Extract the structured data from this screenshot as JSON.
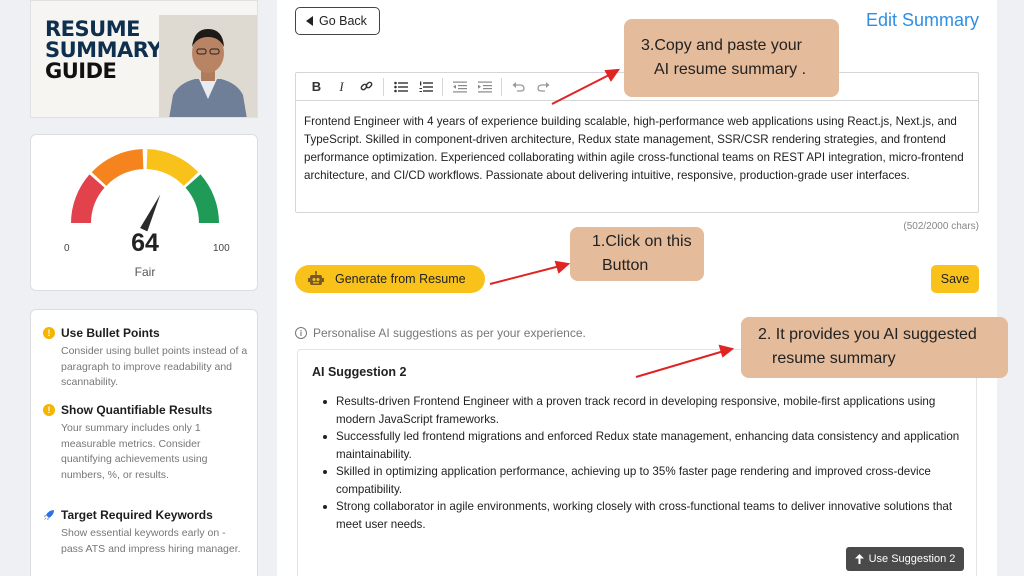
{
  "sidebar": {
    "guide_title": [
      "RESUME",
      "SUMMARY",
      "GUIDE"
    ],
    "score": {
      "value": "64",
      "min": "0",
      "max": "100",
      "label": "Fair",
      "fraction": 0.64
    },
    "tips": [
      {
        "title": "Use Bullet Points",
        "body": "Consider using bullet points instead of a paragraph to improve readability and scannability.",
        "icon": "warning-icon"
      },
      {
        "title": "Show Quantifiable Results",
        "body": "Your summary includes only 1 measurable metrics. Consider quantifying achievements using numbers, %, or results.",
        "icon": "warning-icon"
      },
      {
        "title": "Target Required Keywords",
        "body": "Show essential keywords early on - pass ATS and impress hiring manager.",
        "icon": "rocket-icon"
      }
    ]
  },
  "header": {
    "back_label": "Go Back",
    "title": "Edit Summary"
  },
  "toolbar": [
    "B",
    "I",
    "link",
    "bullet-list",
    "numbered-list",
    "outdent",
    "indent",
    "undo",
    "redo"
  ],
  "editor": {
    "text": "Frontend Engineer with 4 years of experience building scalable, high-performance web applications using React.js, Next.js, and TypeScript. Skilled in component-driven architecture, Redux state management, SSR/CSR rendering strategies, and frontend performance optimization. Experienced collaborating within agile cross-functional teams on REST API integration, micro-frontend architecture, and CI/CD workflows. Passionate about delivering intuitive, responsive, production-grade user interfaces.",
    "char_count": "(502/2000 chars)"
  },
  "actions": {
    "generate_label": "Generate from Resume",
    "save_label": "Save"
  },
  "personalise_text": "Personalise AI suggestions as per your experience.",
  "suggestion": {
    "title": "AI Suggestion 2",
    "items": [
      "Results-driven Frontend Engineer with a proven track record in developing responsive, mobile-first applications using modern JavaScript frameworks.",
      "Successfully led frontend migrations and enforced Redux state management, enhancing data consistency and application maintainability.",
      "Skilled in optimizing application performance, achieving up to 35% faster page rendering and improved cross-device compatibility.",
      "Strong collaborator in agile environments, working closely with cross-functional teams to deliver innovative solutions that meet user needs."
    ],
    "use_label": "Use Suggestion 2"
  },
  "callouts": {
    "copy_paste": [
      "3.Copy and paste your",
      "AI resume summary ."
    ],
    "click_button": [
      "1.Click on this",
      "Button"
    ],
    "ai_suggested": [
      "2. It provides you AI suggested",
      "resume summary"
    ]
  },
  "colors": {
    "accent_yellow": "#f9c21a",
    "link_blue": "#2f8fe3",
    "callout": "#e4bb9b",
    "arrow": "#e02424"
  }
}
